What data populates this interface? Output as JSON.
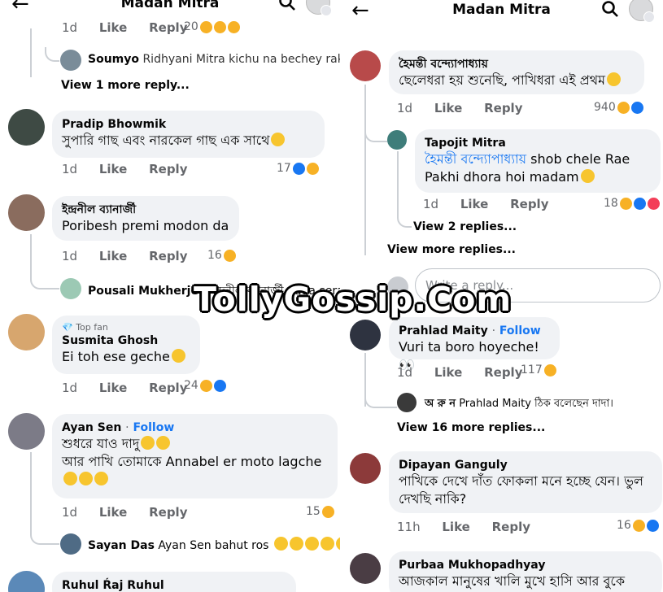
{
  "header": {
    "title": "Madan Mitra",
    "back_icon": "arrow-left-icon",
    "search_icon": "search-icon"
  },
  "left": {
    "top_actions": {
      "time": "1d",
      "like": "Like",
      "reply": "Reply",
      "count": "20"
    },
    "reply_soumyo": {
      "name": "Soumyo",
      "text": "Ridhyani Mitra kichu na bechey rakhl..."
    },
    "more1": "View 1 more reply...",
    "comments": [
      {
        "name": "Pradip Bhowmik",
        "text": "সুপারি গাছ এবং নারকেল গাছ এক সাথে",
        "time": "1d",
        "like": "Like",
        "reply": "Reply",
        "count": "17"
      },
      {
        "name": "ইন্দ্রনীল ব্যানার্জী",
        "text": "Poribesh premi modon da",
        "time": "1d",
        "like": "Like",
        "reply": "Reply",
        "count": "16"
      },
      {
        "badge": "Top fan",
        "name": "Susmita Ghosh",
        "text": "Ei toh ese geche",
        "time": "1d",
        "like": "Like",
        "reply": "Reply",
        "count": "24"
      },
      {
        "name": "Ayan Sen",
        "follow": "Follow",
        "text1": "শুধরে যাও দাদু",
        "text2": "আর পাখি তোমাকে Annabel er moto lagche",
        "time": "1d",
        "like": "Like",
        "reply": "Reply",
        "count": "15"
      },
      {
        "name": "Ruhul Ŕaj Ruhul"
      }
    ],
    "reply_pousali": {
      "name": "Pousali Mukherjee",
      "text": "ইন্দ্রনীল ব্যানার্জী dada sera"
    },
    "reply_sayan": {
      "name": "Sayan Das",
      "text": "Ayan Sen bahut ros"
    }
  },
  "right": {
    "comments": [
      {
        "name": "হৈমন্তী বন্দ্যোপাধ্যায়",
        "text": "ছেলেধরা হয় শুনেছি, পাখিধরা এই প্রথম",
        "time": "1d",
        "like": "Like",
        "reply": "Reply",
        "count": "940"
      },
      {
        "name": "Tapojit Mitra",
        "mention": "হৈমন্তী বন্দ্যোপাধ্যায়",
        "text1": "shob chele Rae",
        "text2": "Pakhi dhora hoi madam",
        "time": "1d",
        "like": "Like",
        "reply": "Reply",
        "count": "18"
      },
      {
        "name": "Prahlad Maity",
        "follow": "Follow",
        "text": "Vuri ta boro hoyeche!",
        "time": "1d",
        "like": "Like",
        "reply": "Reply",
        "count": "117"
      },
      {
        "name": "Dipayan Ganguly",
        "text1": "পাখিকে দেখে দাঁত ফোকলা মনে হচ্ছে যেন। ভুল",
        "text2": "দেখছি নাকি?",
        "time": "11h",
        "like": "Like",
        "reply": "Reply",
        "count": "16"
      },
      {
        "name": "Purbaa Mukhopadhyay",
        "text": "আজকাল মানুষের খালি মুখে হাসি আর বুকে"
      }
    ],
    "view2": "View 2 replies...",
    "view_more": "View more replies...",
    "write_placeholder": "Write a reply...",
    "reply_arun": {
      "name": "অ রু ন",
      "text": "Prahlad Maity ঠিক বলেছেন দাদা।"
    },
    "view16": "View 16 more replies..."
  },
  "watermark": "TollyGossip.Com",
  "colors": {
    "link": "#1877f2",
    "bubble": "#f0f2f5",
    "meta": "#65676b"
  }
}
